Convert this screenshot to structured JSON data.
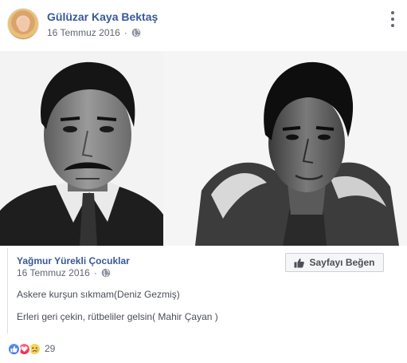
{
  "post": {
    "author": "Gülüzar Kaya Bektaş",
    "date": "16 Temmuz 2016",
    "privacy_icon": "globe-icon",
    "options_icon": "more-options-icon"
  },
  "photos": [
    {
      "name": "left-portrait-photo"
    },
    {
      "name": "right-portrait-photo"
    }
  ],
  "shared": {
    "page_name": "Yağmur Yürekli Çocuklar",
    "date": "16 Temmuz 2016",
    "like_page_label": "Sayfayı Beğen",
    "line1": "Askere kurşun sıkmam(Deniz Gezmiş)",
    "line2": "Erleri geri çekin, rütbeliler gelsin( Mahir Çayan )"
  },
  "reactions": {
    "icons": [
      "like-reaction-icon",
      "love-reaction-icon",
      "sad-reaction-icon"
    ],
    "count": "29",
    "colors": {
      "like": "#4b7bec",
      "love": "#f0284a",
      "sad": "#f7d258"
    }
  },
  "colors": {
    "link": "#385898",
    "meta": "#616770",
    "border": "#dadde1"
  }
}
